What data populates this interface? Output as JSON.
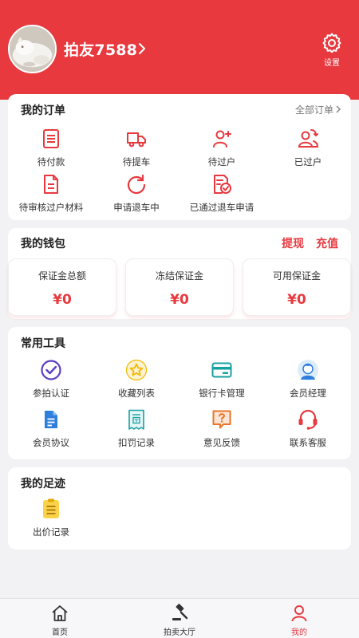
{
  "colors": {
    "brand": "#e8393f",
    "blue": "#2e7fdd",
    "purple": "#5b3fc4",
    "yellow": "#f2b705",
    "teal": "#17a2a2",
    "orange": "#e8762a"
  },
  "header": {
    "username": "拍友7588",
    "avatar_icon": "cat-photo",
    "settings_label": "设置",
    "settings_icon": "gear-icon"
  },
  "orders": {
    "title": "我的订单",
    "all_link": "全部订单",
    "items": [
      {
        "label": "待付款",
        "icon": "document-list-icon"
      },
      {
        "label": "待提车",
        "icon": "truck-icon"
      },
      {
        "label": "待过户",
        "icon": "user-add-icon"
      },
      {
        "label": "已过户",
        "icon": "users-transfer-icon"
      },
      {
        "label": "待审核过户材料",
        "icon": "file-icon"
      },
      {
        "label": "申请退车中",
        "icon": "refresh-icon"
      },
      {
        "label": "已通过退车申请",
        "icon": "file-check-icon"
      }
    ]
  },
  "wallet": {
    "title": "我的钱包",
    "withdraw": "提现",
    "recharge": "充值",
    "boxes": [
      {
        "label": "保证金总额",
        "value": "¥0"
      },
      {
        "label": "冻结保证金",
        "value": "¥0"
      },
      {
        "label": "可用保证金",
        "value": "¥0"
      }
    ]
  },
  "tools": {
    "title": "常用工具",
    "items": [
      {
        "label": "参拍认证",
        "icon": "check-circle-icon"
      },
      {
        "label": "收藏列表",
        "icon": "star-icon"
      },
      {
        "label": "银行卡管理",
        "icon": "bank-card-icon"
      },
      {
        "label": "会员经理",
        "icon": "manager-avatar-icon"
      },
      {
        "label": "会员协议",
        "icon": "agreement-doc-icon"
      },
      {
        "label": "扣罚记录",
        "icon": "receipt-icon"
      },
      {
        "label": "意见反馈",
        "icon": "feedback-icon"
      },
      {
        "label": "联系客服",
        "icon": "headset-icon"
      }
    ]
  },
  "footprint": {
    "title": "我的足迹",
    "items": [
      {
        "label": "出价记录",
        "icon": "bid-record-icon"
      }
    ]
  },
  "tabbar": {
    "items": [
      {
        "label": "首页",
        "icon": "home-icon",
        "active": false
      },
      {
        "label": "拍卖大厅",
        "icon": "gavel-icon",
        "active": false
      },
      {
        "label": "我的",
        "icon": "user-icon",
        "active": true
      }
    ]
  }
}
